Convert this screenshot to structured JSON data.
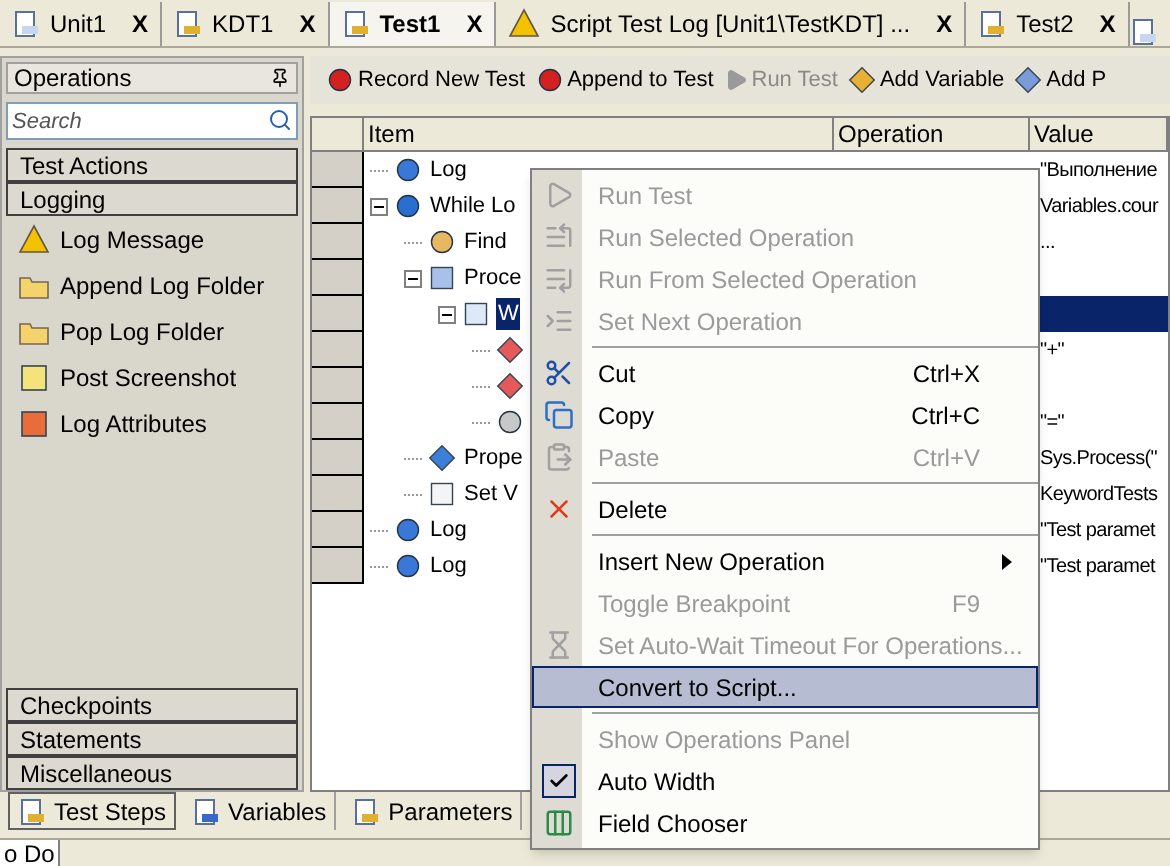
{
  "document_tabs": [
    {
      "label": "Unit1",
      "close": "X",
      "selected": false
    },
    {
      "label": "KDT1",
      "close": "X",
      "selected": false
    },
    {
      "label": "Test1",
      "close": "X",
      "selected": true
    },
    {
      "label": "Script Test Log [Unit1\\TestKDT] ...",
      "close": "X",
      "selected": false
    },
    {
      "label": "Test2",
      "close": "X",
      "selected": false
    }
  ],
  "operations_panel": {
    "title": "Operations",
    "search": {
      "placeholder": "Search"
    },
    "categories": [
      {
        "label": "Test Actions"
      },
      {
        "label": "Logging",
        "items": [
          "Log Message",
          "Append Log Folder",
          "Pop Log Folder",
          "Post Screenshot",
          "Log Attributes"
        ]
      }
    ],
    "bottom_categories": [
      "Checkpoints",
      "Statements",
      "Miscellaneous"
    ]
  },
  "toolbar": [
    {
      "label": "Record New Test",
      "disabled": false
    },
    {
      "label": "Append to Test",
      "disabled": false
    },
    {
      "label": "Run Test",
      "disabled": true
    },
    {
      "label": "Add Variable",
      "disabled": false
    },
    {
      "label": "Add P",
      "disabled": false
    }
  ],
  "table": {
    "columns": [
      "Item",
      "Operation",
      "Value"
    ],
    "rows": [
      {
        "kind": "log",
        "label": "Log",
        "value": "\"Выполнение",
        "selected": false
      },
      {
        "kind": "loop",
        "label": "While Lo",
        "value": "Variables.cour",
        "selected": false,
        "expanded": true,
        "children": [
          {
            "kind": "find",
            "label": "Find",
            "value": "...",
            "selected": false
          },
          {
            "kind": "process",
            "label": "Proce",
            "selected": false,
            "expanded": true,
            "children": [
              {
                "kind": "window",
                "label": "W",
                "selected": true,
                "expanded": true,
                "children": [
                  {
                    "kind": "step",
                    "value": "\"+\"",
                    "selected": false
                  },
                  {
                    "kind": "step",
                    "selected": false
                  },
                  {
                    "kind": "call",
                    "value": "\"=\"",
                    "selected": false
                  }
                ]
              }
            ]
          },
          {
            "kind": "property",
            "label": "Prope",
            "value": "Sys.Process(\"",
            "selected": false
          },
          {
            "kind": "set",
            "label": "Set V",
            "value": "KeywordTests",
            "selected": false
          }
        ]
      },
      {
        "kind": "log",
        "label": "Log",
        "value": "\"Test paramet",
        "selected": false
      },
      {
        "kind": "log",
        "label": "Log",
        "value": "\"Test paramet",
        "selected": false
      }
    ]
  },
  "bottom_tabs": [
    {
      "label": "Test Steps",
      "selected": true
    },
    {
      "label": "Variables",
      "selected": false
    },
    {
      "label": "Parameters",
      "selected": false
    }
  ],
  "status_tab": "o Do",
  "context_menu": [
    {
      "kind": "item",
      "label": "Run Test",
      "disabled": true,
      "selected": false,
      "checked": false,
      "submenu": false
    },
    {
      "kind": "item",
      "label": "Run Selected Operation",
      "disabled": true,
      "selected": false,
      "checked": false,
      "submenu": false
    },
    {
      "kind": "item",
      "label": "Run From Selected Operation",
      "disabled": true,
      "selected": false,
      "checked": false,
      "submenu": false
    },
    {
      "kind": "item",
      "label": "Set Next Operation",
      "disabled": true,
      "selected": false,
      "checked": false,
      "submenu": false
    },
    {
      "kind": "separator"
    },
    {
      "kind": "item",
      "label": "Cut",
      "shortcut": "Ctrl+X",
      "disabled": false,
      "selected": false,
      "checked": false,
      "submenu": false
    },
    {
      "kind": "item",
      "label": "Copy",
      "shortcut": "Ctrl+C",
      "disabled": false,
      "selected": false,
      "checked": false,
      "submenu": false
    },
    {
      "kind": "item",
      "label": "Paste",
      "shortcut": "Ctrl+V",
      "disabled": true,
      "selected": false,
      "checked": false,
      "submenu": false
    },
    {
      "kind": "separator"
    },
    {
      "kind": "item",
      "label": "Delete",
      "disabled": false,
      "selected": false,
      "checked": false,
      "submenu": false
    },
    {
      "kind": "separator"
    },
    {
      "kind": "item",
      "label": "Insert New Operation",
      "disabled": false,
      "selected": false,
      "checked": false,
      "submenu": true
    },
    {
      "kind": "item",
      "label": "Toggle Breakpoint",
      "shortcut": "F9",
      "disabled": true,
      "selected": false,
      "checked": false,
      "submenu": false
    },
    {
      "kind": "item",
      "label": "Set Auto-Wait Timeout For Operations...",
      "disabled": true,
      "selected": false,
      "checked": false,
      "submenu": false
    },
    {
      "kind": "item",
      "label": "Convert to Script...",
      "disabled": false,
      "selected": true,
      "checked": false,
      "submenu": false
    },
    {
      "kind": "separator"
    },
    {
      "kind": "item",
      "label": "Show Operations Panel",
      "disabled": true,
      "selected": false,
      "checked": false,
      "submenu": false
    },
    {
      "kind": "item",
      "label": "Auto Width",
      "disabled": false,
      "selected": false,
      "checked": true,
      "submenu": false
    },
    {
      "kind": "item",
      "label": "Field Chooser",
      "disabled": false,
      "selected": false,
      "checked": false,
      "submenu": false
    }
  ]
}
